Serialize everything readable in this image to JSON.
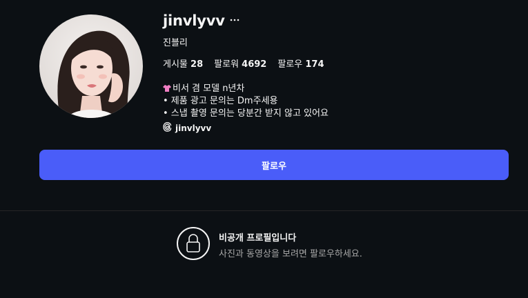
{
  "profile": {
    "username": "jinvlyvv",
    "display_name": "진블리",
    "more_options_icon": "ellipsis-icon",
    "avatar_icon": "profile-photo"
  },
  "stats": {
    "posts_label": "게시물",
    "posts_count": "28",
    "followers_label": "팔로워",
    "followers_count": "4692",
    "following_label": "팔로우",
    "following_count": "174"
  },
  "bio": {
    "line1": "비서 겸 모델 n년차",
    "line2": "• 제품 광고 문의는 Dm주세용",
    "line3": "• 스냅 촬영 문의는 당분간 받지 않고 있어요",
    "line1_emoji": "tshirt-icon"
  },
  "threads": {
    "handle": "jinvlyvv",
    "icon": "threads-icon"
  },
  "actions": {
    "follow_label": "팔로우"
  },
  "private_notice": {
    "title": "비공개 프로필입니다",
    "description": "사진과 동영상을 보려면 팔로우하세요.",
    "icon": "lock-icon"
  },
  "colors": {
    "background": "#0c1014",
    "accent": "#4a5df9",
    "muted_text": "#a8a8a8",
    "divider": "#262626"
  }
}
